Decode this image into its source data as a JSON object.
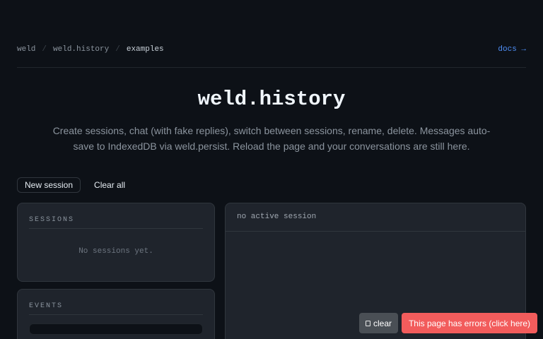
{
  "breadcrumb": {
    "items": [
      "weld",
      "weld.history",
      "examples"
    ],
    "separator": "/",
    "docs_link": "docs →"
  },
  "hero": {
    "title": "weld.history",
    "description": "Create sessions, chat (with fake replies), switch between sessions, rename, delete. Messages auto-save to IndexedDB via weld.persist. Reload the page and your conversations are still here."
  },
  "actions": {
    "new_session": "New session",
    "clear_all": "Clear all"
  },
  "sessions": {
    "heading": "SESSIONS",
    "empty": "No sessions yet."
  },
  "events": {
    "heading": "EVENTS"
  },
  "chat": {
    "header": "no active session"
  },
  "error_overlay": {
    "clear_label": "clear",
    "message": "This page has errors (click here)"
  },
  "colors": {
    "background": "#0d1117",
    "panel": "#1f242c",
    "link_accent": "#4f8ff7",
    "error": "#f25c5c"
  }
}
